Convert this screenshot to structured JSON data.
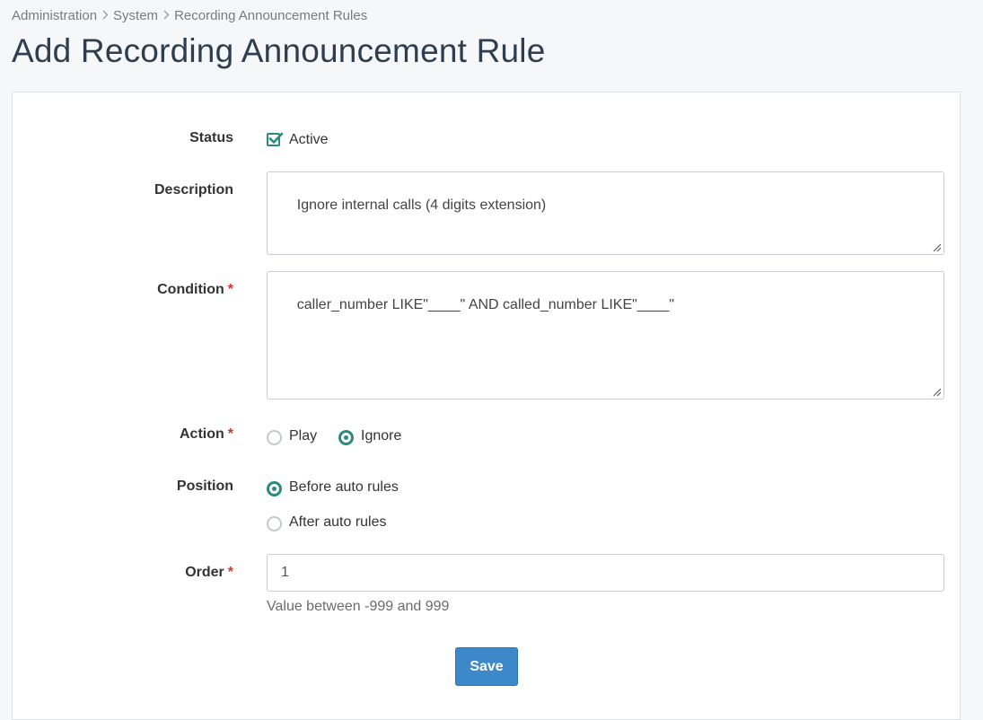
{
  "breadcrumb": {
    "items": [
      "Administration",
      "System",
      "Recording Announcement Rules"
    ],
    "separator_icon": "chevron-right-icon"
  },
  "page_title": "Add Recording Announcement Rule",
  "form": {
    "status": {
      "label": "Status",
      "checkbox_label": "Active",
      "checked": true
    },
    "description": {
      "label": "Description",
      "value": "Ignore internal calls (4 digits extension)"
    },
    "condition": {
      "label": "Condition",
      "required_mark": "*",
      "value": "caller_number LIKE\"____\" AND called_number LIKE\"____\""
    },
    "action": {
      "label": "Action",
      "required_mark": "*",
      "options": [
        "Play",
        "Ignore"
      ],
      "selected": "Ignore"
    },
    "position": {
      "label": "Position",
      "options": [
        "Before auto rules",
        "After auto rules"
      ],
      "selected": "Before auto rules"
    },
    "order": {
      "label": "Order",
      "required_mark": "*",
      "value": "1",
      "help": "Value between -999 and 999"
    },
    "save_label": "Save"
  },
  "colors": {
    "accent": "#2b8a7b",
    "primary_button": "#3d88c9",
    "required": "#d9322d",
    "title": "#2c3e50"
  }
}
